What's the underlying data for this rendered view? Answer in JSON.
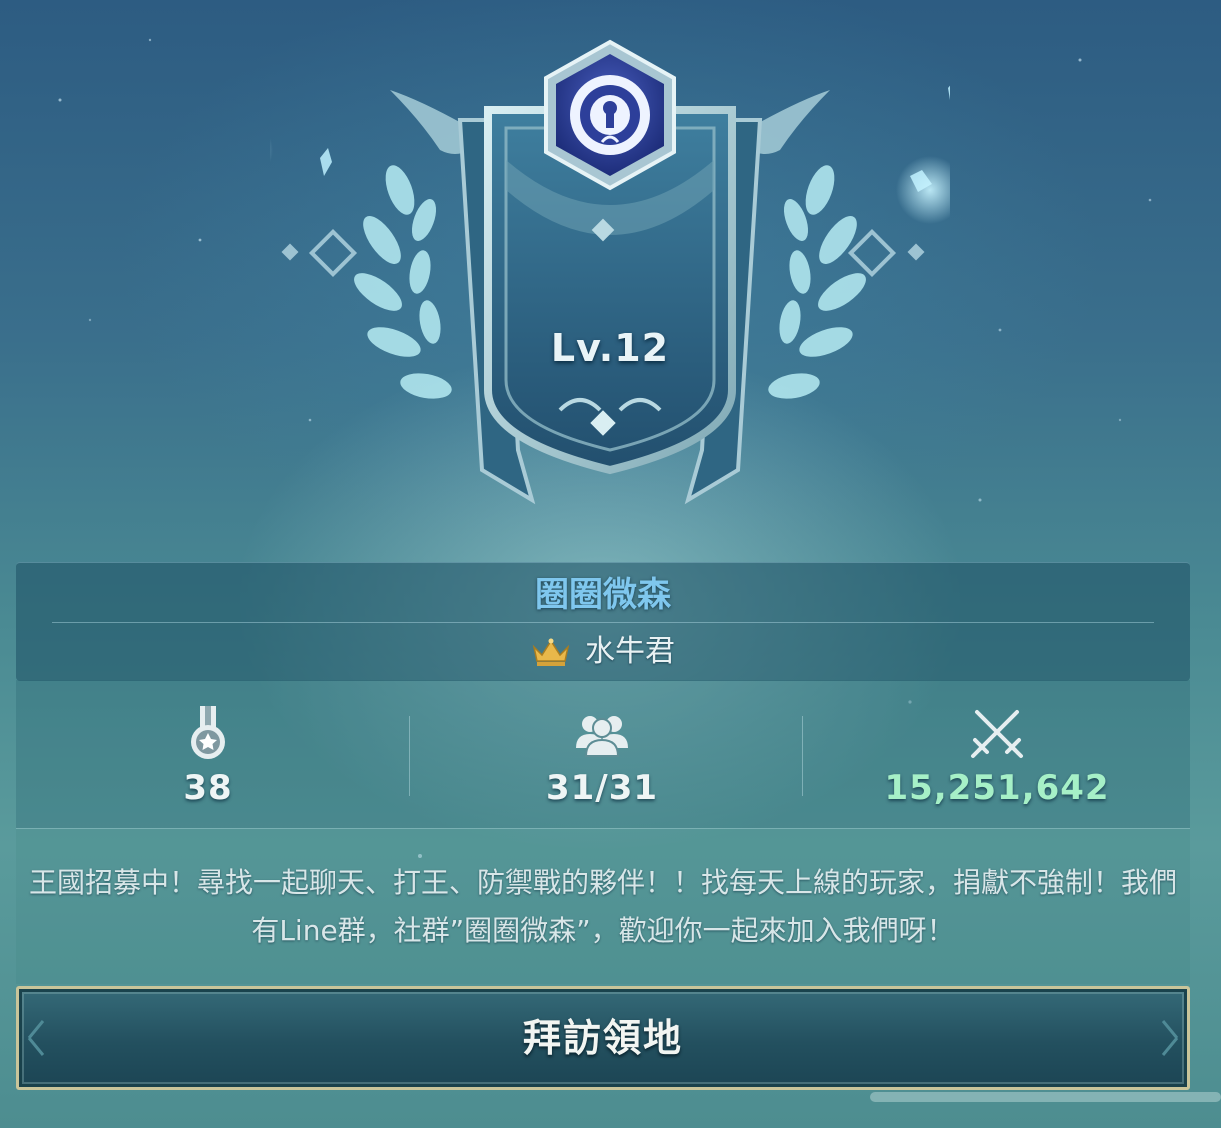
{
  "guild": {
    "level_label": "Lv.12",
    "name": "圈圈微森",
    "leader": "水牛君"
  },
  "stats": {
    "level": "38",
    "members": "31/31",
    "power": "15,251,642"
  },
  "description": "王國招募中！尋找一起聊天、打王、防禦戰的夥伴！！找每天上線的玩家，捐獻不強制！我們有Line群，社群”圈圈微森”，歡迎你一起來加入我們呀！",
  "actions": {
    "visit_label": "拜訪領地"
  },
  "icons": {
    "emblem": "guild-crest-icon",
    "crown": "crown-icon",
    "level": "medal-icon",
    "members": "members-icon",
    "power": "crossed-swords-icon"
  },
  "colors": {
    "guild_name": "#7fc7ee",
    "power_value": "#a6f0c7",
    "button_border": "#c9c59a",
    "crown": "#e8b84a"
  }
}
